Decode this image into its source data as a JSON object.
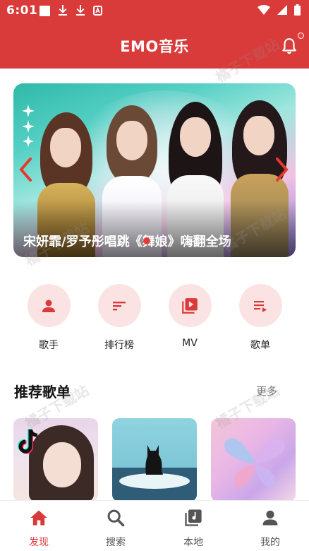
{
  "status_bar": {
    "time": "6:01"
  },
  "header": {
    "title": "EMO音乐"
  },
  "banner": {
    "caption": "宋妍霏/罗予彤唱跳《舞娘》嗨翻全场",
    "active_index": 0
  },
  "quick_nav": [
    {
      "label": "歌手",
      "icon": "person-icon"
    },
    {
      "label": "排行榜",
      "icon": "sort-list-icon"
    },
    {
      "label": "MV",
      "icon": "video-library-icon"
    },
    {
      "label": "歌单",
      "icon": "playlist-play-icon"
    }
  ],
  "recommend": {
    "title": "推荐歌单",
    "more": "更多"
  },
  "bottom_nav": [
    {
      "label": "发现",
      "icon": "home-icon",
      "active": true
    },
    {
      "label": "搜索",
      "icon": "search-icon",
      "active": false
    },
    {
      "label": "本地",
      "icon": "music-library-icon",
      "active": false
    },
    {
      "label": "我的",
      "icon": "profile-icon",
      "active": false
    }
  ],
  "colors": {
    "brand": "#d93a3a",
    "accent_light": "#fbe3e3"
  }
}
